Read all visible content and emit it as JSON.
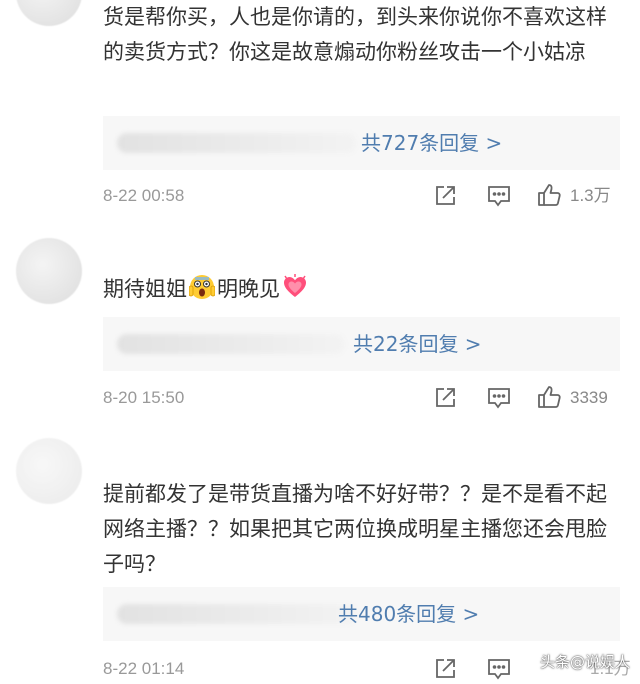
{
  "comments": [
    {
      "text": "货是帮你买，人也是你请的，到头来你说你不喜欢这样的卖货方式？你这是故意煽动你粉丝攻击一个小姑凉",
      "replies": "共727条回复 >",
      "time": "8-22 00:58",
      "likes": "1.3万"
    },
    {
      "text_a": "期待姐姐",
      "text_b": "明晚见",
      "replies": "共22条回复 >",
      "time": "8-20 15:50",
      "likes": "3339"
    },
    {
      "text": "提前都发了是带货直播为啥不好好带？？是不是看不起网络主播？？如果把其它两位换成明星主播您还会甩脸子吗？",
      "replies": "共480条回复 >",
      "time": "8-22 01:14",
      "likes": "1.1万"
    }
  ],
  "watermark": "头条@说娱人",
  "icons": {
    "share": "share-icon",
    "comment": "comment-icon",
    "like": "thumbs-up-icon",
    "emoji_scream": "screaming-face-icon",
    "emoji_heart": "growing-heart-icon"
  }
}
